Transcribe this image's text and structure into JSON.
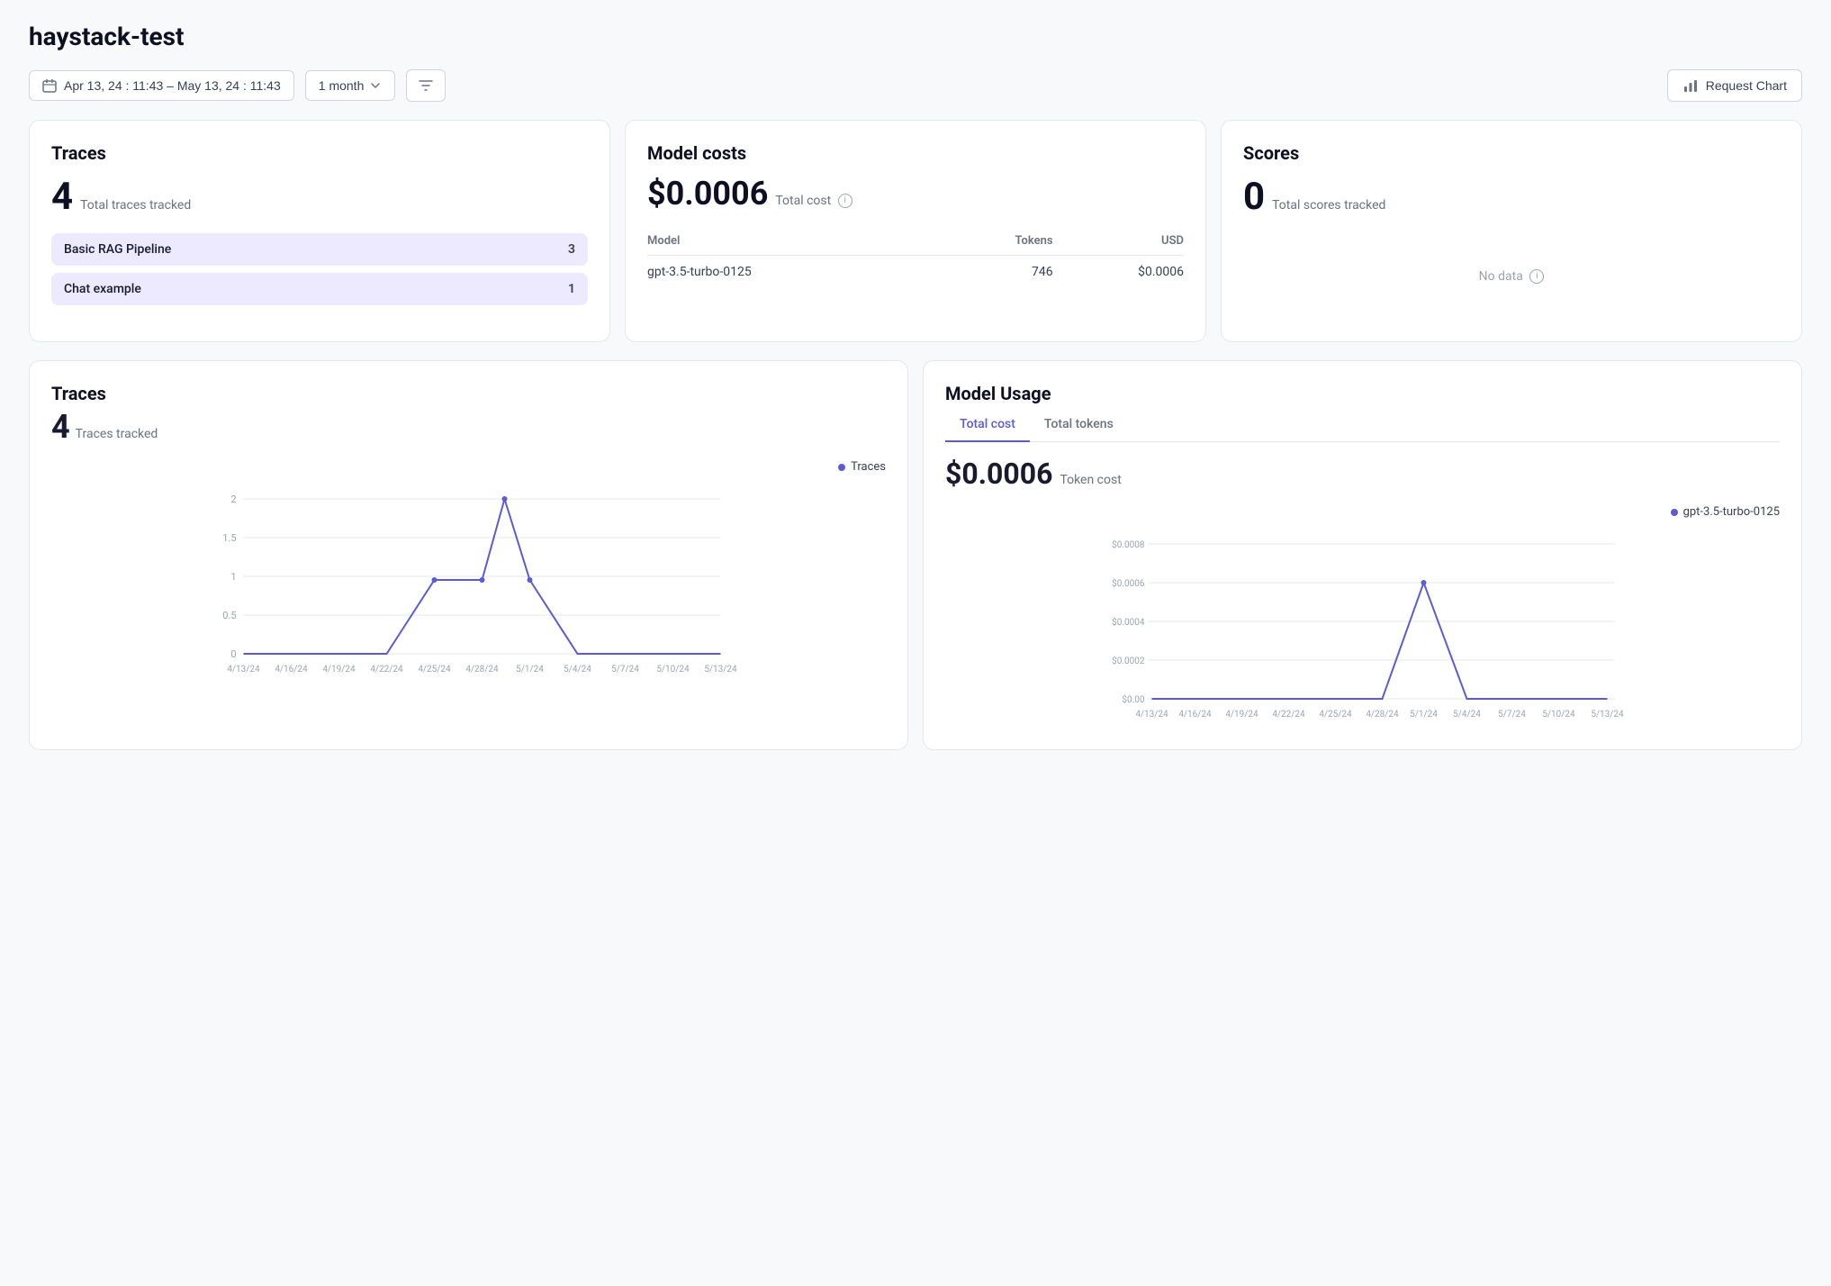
{
  "page": {
    "title": "haystack-test"
  },
  "toolbar": {
    "date_range": "Apr 13, 24 : 11:43 – May 13, 24 : 11:43",
    "period": "1 month",
    "request_chart_label": "Request Chart"
  },
  "traces_card": {
    "title": "Traces",
    "metric": "4",
    "metric_label": "Total traces tracked",
    "pipelines": [
      {
        "name": "Basic RAG Pipeline",
        "count": "3"
      },
      {
        "name": "Chat example",
        "count": "1"
      }
    ]
  },
  "model_costs_card": {
    "title": "Model costs",
    "metric": "$0.0006",
    "metric_label": "Total cost",
    "table": {
      "headers": [
        "Model",
        "Tokens",
        "USD"
      ],
      "rows": [
        {
          "model": "gpt-3.5-turbo-0125",
          "tokens": "746",
          "usd": "$0.0006"
        }
      ]
    }
  },
  "scores_card": {
    "title": "Scores",
    "metric": "0",
    "metric_label": "Total scores tracked",
    "no_data": "No data"
  },
  "traces_chart": {
    "title": "Traces",
    "subtitle_count": "4",
    "subtitle_label": "Traces tracked",
    "legend": "Traces",
    "y_labels": [
      "2",
      "1.5",
      "1",
      "0.5",
      "0"
    ],
    "x_labels": [
      "4/13/24",
      "4/16/24",
      "4/19/24",
      "4/22/24",
      "4/25/24",
      "4/28/24",
      "5/1/24",
      "5/4/24",
      "5/7/24",
      "5/10/24",
      "5/13/24"
    ]
  },
  "model_usage_chart": {
    "title": "Model Usage",
    "tabs": [
      "Total cost",
      "Total tokens"
    ],
    "active_tab": "Total cost",
    "metric": "$0.0006",
    "metric_label": "Token cost",
    "legend": "gpt-3.5-turbo-0125",
    "y_labels": [
      "$0.0008",
      "$0.0006",
      "$0.0004",
      "$0.0002",
      "$0.00"
    ],
    "x_labels": [
      "4/13/24",
      "4/16/24",
      "4/19/24",
      "4/22/24",
      "4/25/24",
      "4/28/24",
      "5/1/24",
      "5/4/24",
      "5/7/24",
      "5/10/24",
      "5/13/24"
    ]
  }
}
